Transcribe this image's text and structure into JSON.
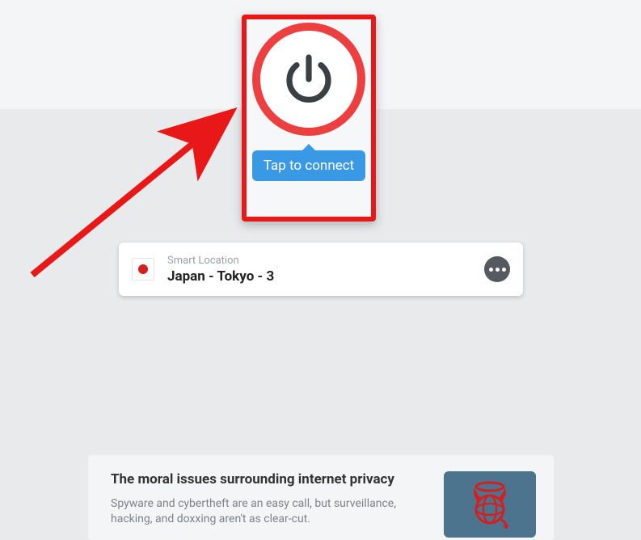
{
  "connect": {
    "tooltip": "Tap to connect"
  },
  "location": {
    "label": "Smart Location",
    "name": "Japan - Tokyo - 3",
    "flag_country": "japan"
  },
  "article": {
    "title": "The moral issues surrounding internet privacy",
    "desc": "Spyware and cybertheft are an easy call, but surveillance, hacking, and doxxing aren't as clear-cut."
  },
  "colors": {
    "accent_red": "#ec4040",
    "tooltip_blue": "#3a99e5",
    "thumb_bg": "#4c748e",
    "annotation_red": "#e81818"
  }
}
